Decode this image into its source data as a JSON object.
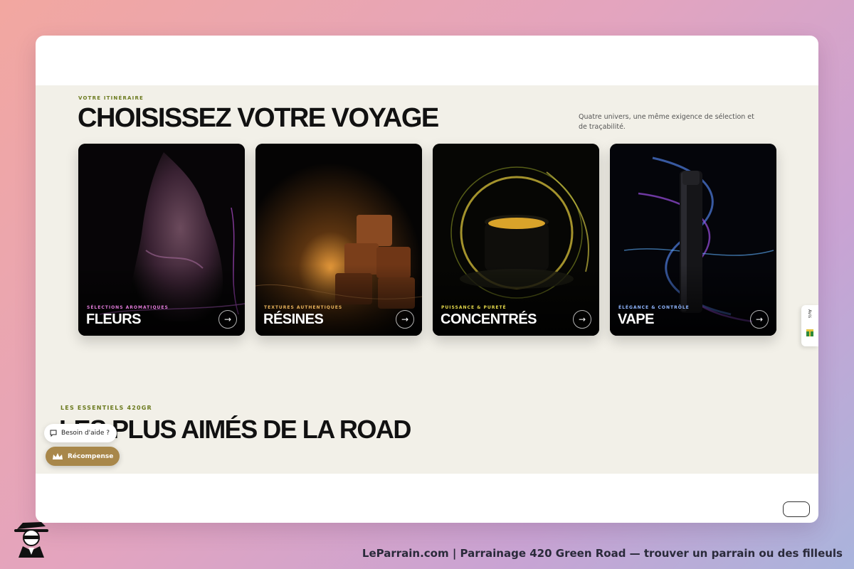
{
  "journey": {
    "eyebrow": "VOTRE ITINÉRAIRE",
    "title": "CHOISISSEZ VOTRE VOYAGE",
    "intro": "Quatre univers, une même exigence de sélection et de traçabilité."
  },
  "cards": [
    {
      "tag": "SÉLECTIONS AROMATIQUES",
      "title": "FLEURS",
      "tag_color": "#e07ad8",
      "icon": "arrow-right-icon",
      "arrow": "→"
    },
    {
      "tag": "TEXTURES AUTHENTIQUES",
      "title": "RÉSINES",
      "tag_color": "#e6b15a",
      "icon": "arrow-right-icon",
      "arrow": "→"
    },
    {
      "tag": "PUISSANCE & PURETÉ",
      "title": "CONCENTRÉS",
      "tag_color": "#e4d84a",
      "icon": "arrow-right-icon",
      "arrow": "→"
    },
    {
      "tag": "ÉLÉGANCE & CONTRÔLE",
      "title": "VAPE",
      "tag_color": "#8fb6ff",
      "icon": "arrow-right-icon",
      "arrow": "→"
    }
  ],
  "essentials": {
    "eyebrow": "LES ESSENTIELS 420GR",
    "title": "LES PLUS AIMÉS DE LA ROAD"
  },
  "widgets": {
    "help_label": "Besoin d'aide ?",
    "reward_label": "Récompense",
    "side_tab_label": "Avis"
  },
  "footer": {
    "caption": "LeParrain.com | Parrainage 420 Green Road — trouver un parrain ou des filleuls"
  },
  "colors": {
    "accent_olive": "#6b7a1e",
    "reward_gold": "#a8874a",
    "page_bg": "#f2f0e8"
  }
}
